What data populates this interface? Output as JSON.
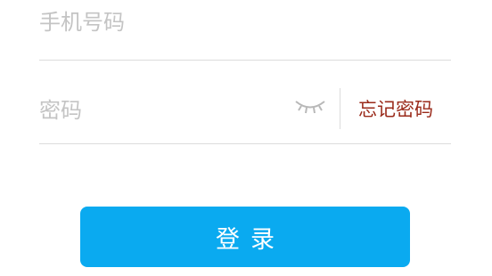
{
  "phone": {
    "placeholder": "手机号码",
    "value": ""
  },
  "password": {
    "placeholder": "密码",
    "value": "",
    "visibility_icon": "eye-closed-icon"
  },
  "forgot_password": {
    "label": "忘记密码",
    "color": "#9a2a1a"
  },
  "login_button": {
    "label": "登录",
    "color": "#0aaaf0"
  }
}
